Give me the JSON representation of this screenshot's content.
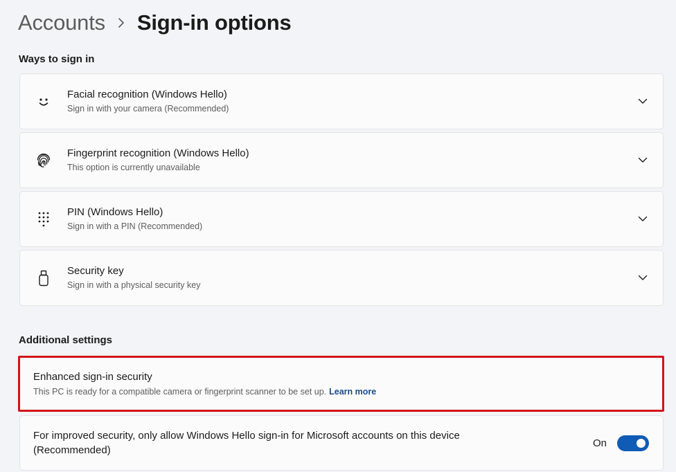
{
  "breadcrumb": {
    "parent": "Accounts",
    "current": "Sign-in options",
    "separator_icon": "chevron-right-icon"
  },
  "ways_section": {
    "title": "Ways to sign in",
    "items": [
      {
        "icon": "smile-face-icon",
        "title": "Facial recognition (Windows Hello)",
        "subtitle": "Sign in with your camera (Recommended)"
      },
      {
        "icon": "fingerprint-icon",
        "title": "Fingerprint recognition (Windows Hello)",
        "subtitle": "This option is currently unavailable"
      },
      {
        "icon": "pin-keypad-icon",
        "title": "PIN (Windows Hello)",
        "subtitle": "Sign in with a PIN (Recommended)"
      },
      {
        "icon": "usb-key-icon",
        "title": "Security key",
        "subtitle": "Sign in with a physical security key"
      }
    ]
  },
  "additional_section": {
    "title": "Additional settings",
    "enhanced": {
      "title": "Enhanced sign-in security",
      "subtitle": "This PC is ready for a compatible camera or fingerprint scanner to be set up.",
      "link": "Learn more"
    },
    "improved": {
      "text_line1": "For improved security, only allow Windows Hello sign-in for Microsoft accounts on this device",
      "text_line2": "(Recommended)",
      "toggle_label": "On",
      "toggle_on": true
    }
  },
  "colors": {
    "accent": "#0f5bb5",
    "highlight_border": "#d4121b",
    "link": "#1a4c8a",
    "background": "#f2f4f7"
  }
}
